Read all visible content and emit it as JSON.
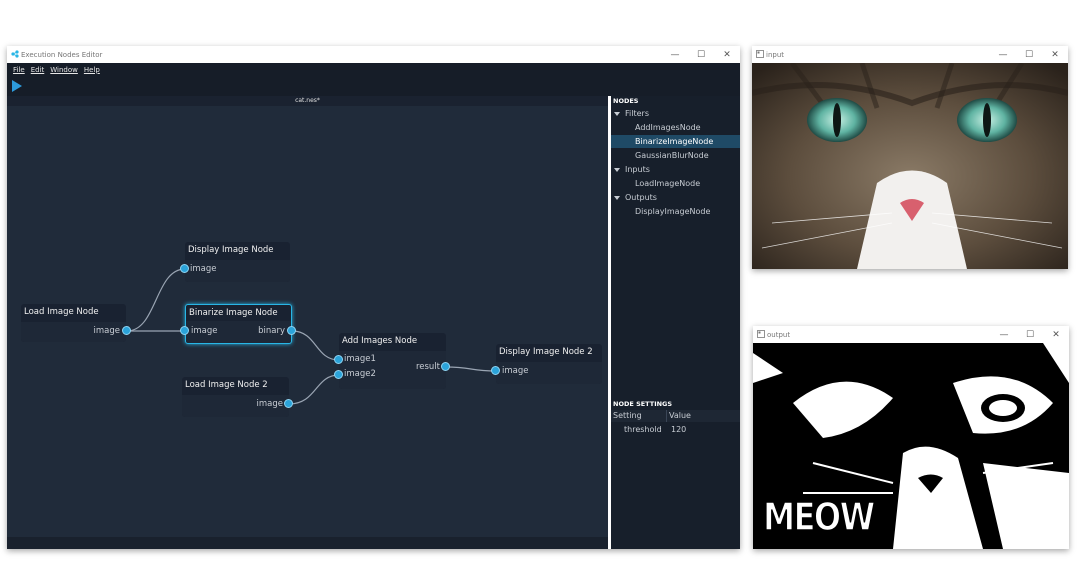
{
  "editor": {
    "title": "Execution Nodes Editor",
    "menu": [
      "File",
      "Edit",
      "Window",
      "Help"
    ],
    "tab_title": "cat.nes*"
  },
  "nodes": {
    "load1": {
      "title": "Load Image Node",
      "out": "image"
    },
    "display1": {
      "title": "Display Image Node",
      "in": "image"
    },
    "binarize": {
      "title": "Binarize Image Node",
      "in": "image",
      "out": "binary"
    },
    "load2": {
      "title": "Load Image Node 2",
      "out": "image"
    },
    "add": {
      "title": "Add Images Node",
      "in1": "image1",
      "in2": "image2",
      "out": "result"
    },
    "display2": {
      "title": "Display Image Node 2",
      "in": "image"
    }
  },
  "panel": {
    "nodes_header": "NODES",
    "tree": [
      {
        "label": "Filters",
        "group": true
      },
      {
        "label": "AddImagesNode",
        "group": false
      },
      {
        "label": "BinarizeImageNode",
        "group": false,
        "selected": true
      },
      {
        "label": "GaussianBlurNode",
        "group": false
      },
      {
        "label": "Inputs",
        "group": true
      },
      {
        "label": "LoadImageNode",
        "group": false
      },
      {
        "label": "Outputs",
        "group": true
      },
      {
        "label": "DisplayImageNode",
        "group": false
      }
    ],
    "settings_header": "NODE SETTINGS",
    "columns": [
      "Setting",
      "Value"
    ],
    "rows": [
      {
        "setting": "threshold",
        "value": "120"
      }
    ]
  },
  "input_window": {
    "title": "input"
  },
  "output_window": {
    "title": "output",
    "caption": "MEOW"
  },
  "colors": {
    "accent": "#29b6e6",
    "canvas": "#202b3a",
    "port": "#2ba3d9",
    "selection": "#1f4a66"
  }
}
